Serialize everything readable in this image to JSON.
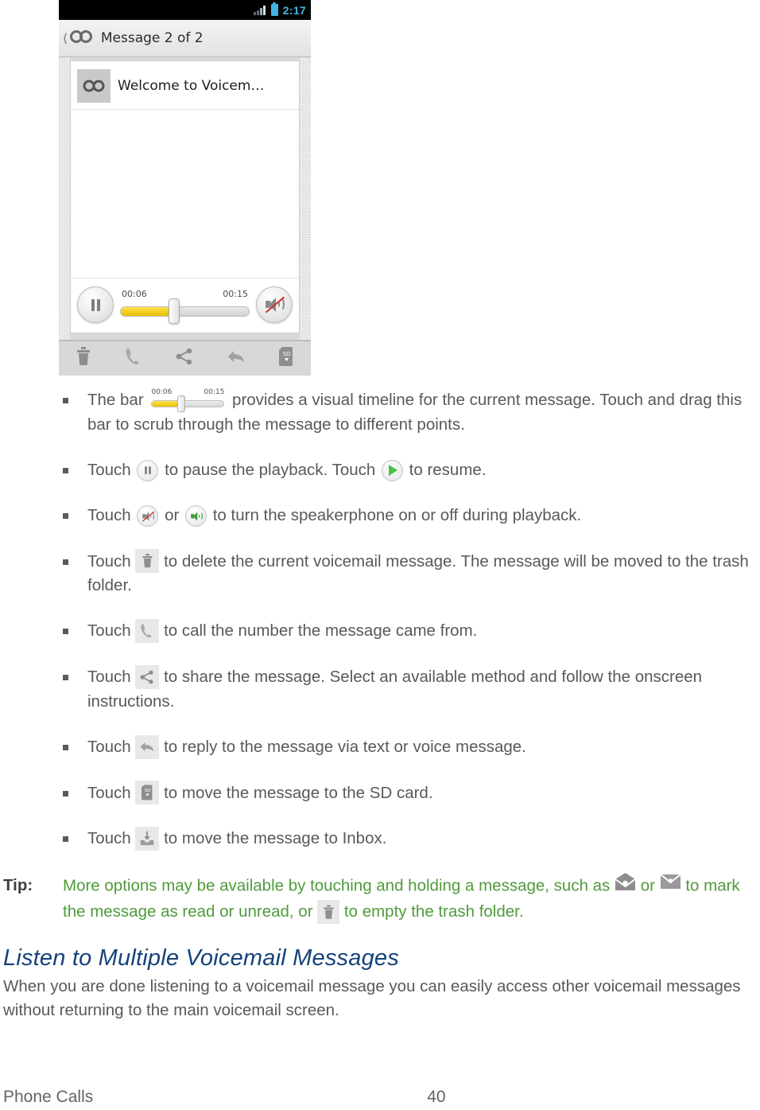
{
  "screenshot": {
    "status_bar": {
      "time": "2:17",
      "signal_icon": "signal-bars-icon",
      "battery_icon": "battery-icon"
    },
    "title_bar": {
      "back_icon": "chevron-left-icon",
      "app_icon": "voicemail-icon",
      "title": "Message 2 of 2"
    },
    "message": {
      "thumb_icon": "voicemail-icon",
      "subject": "Welcome to Voicem…"
    },
    "player": {
      "pause_icon": "pause-icon",
      "elapsed": "00:06",
      "duration": "00:15",
      "speaker_icon": "speaker-muted-icon"
    },
    "toolbar": [
      {
        "icon": "trash-icon",
        "label": "Delete"
      },
      {
        "icon": "phone-icon",
        "label": "Call"
      },
      {
        "icon": "share-icon",
        "label": "Share"
      },
      {
        "icon": "reply-icon",
        "label": "Reply"
      },
      {
        "icon": "sd-card-icon",
        "label": "Save to SD"
      }
    ]
  },
  "bullets": [
    {
      "id": "timeline-bar",
      "pre": "The bar ",
      "icon": "timeline-slider-icon",
      "slider": {
        "elapsed": "00:06",
        "duration": "00:15"
      },
      "post": " provides a visual timeline for the current message. Touch and drag this bar to scrub through the message to different points."
    },
    {
      "id": "pause-resume",
      "pre": "Touch ",
      "icon": "pause-icon",
      "mid": " to pause the playback. Touch ",
      "icon2": "play-icon",
      "post": " to resume."
    },
    {
      "id": "speakerphone",
      "pre": "Touch ",
      "icon": "speaker-muted-icon",
      "mid": " or ",
      "icon2": "speaker-on-icon",
      "post": " to turn the speakerphone on or off during playback."
    },
    {
      "id": "delete-message",
      "pre": "Touch ",
      "icon": "trash-icon",
      "post": " to delete the current voicemail message. The message will be moved to the trash folder."
    },
    {
      "id": "call-back",
      "pre": "Touch ",
      "icon": "phone-icon",
      "post": " to call the number the message came from."
    },
    {
      "id": "share-message",
      "pre": "Touch ",
      "icon": "share-icon",
      "post": " to share the message. Select an available method and follow the onscreen instructions."
    },
    {
      "id": "reply-message",
      "pre": "Touch ",
      "icon": "reply-icon",
      "post": " to reply to the message via text or voice message."
    },
    {
      "id": "move-to-sd",
      "pre": "Touch ",
      "icon": "sd-card-icon",
      "post": " to move the message to the SD card."
    },
    {
      "id": "move-to-inbox",
      "pre": "Touch ",
      "icon": "inbox-icon",
      "post": " to move the message to Inbox."
    }
  ],
  "tip": {
    "label": "Tip:",
    "part1": "More options may be available by touching and holding a message, such as ",
    "icon1": "envelope-open-icon",
    "part2": " or ",
    "icon2": "envelope-closed-icon",
    "part3": " to mark the message as read or unread, or ",
    "icon3": "trash-icon",
    "part4": " to empty the trash folder."
  },
  "section": {
    "heading": "Listen to Multiple Voicemail Messages",
    "body": "When you are done listening to a voicemail message you can easily access other voicemail messages without returning to the main voicemail screen."
  },
  "footer": {
    "left": "Phone Calls",
    "page": "40"
  },
  "colors": {
    "heading": "#15427a",
    "tip_text": "#4f9b3b",
    "body_text": "#595959",
    "accent_yellow": "#e8bf00",
    "status_blue": "#4ab8e4",
    "play_green": "#45c245",
    "mute_red": "#d02b2b"
  }
}
